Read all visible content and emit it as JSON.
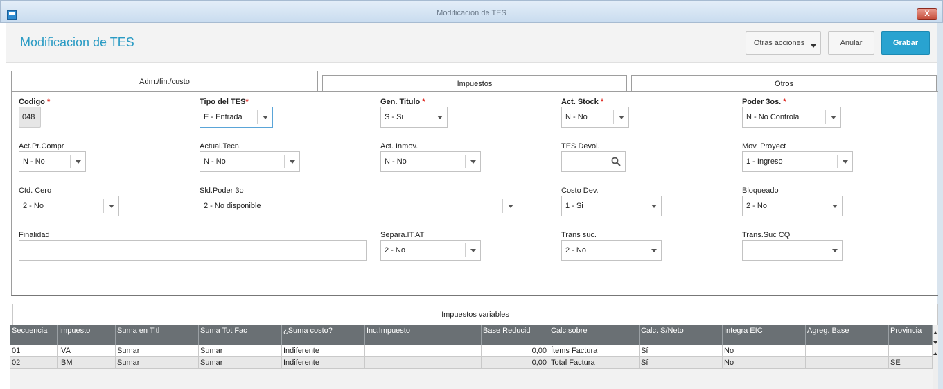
{
  "window": {
    "title": "Modificacion de TES",
    "close_label": "X"
  },
  "header": {
    "title": "Modificacion de TES",
    "other_actions": "Otras acciones",
    "cancel": "Anular",
    "save": "Grabar"
  },
  "tabs": [
    "Adm./fin./custo",
    "Impuestos",
    "Otros"
  ],
  "fields": {
    "codigo": {
      "label": "Codigo",
      "value": "048"
    },
    "tipo_tes": {
      "label": "Tipo del TES",
      "value": "E - Entrada"
    },
    "gen_titulo": {
      "label": "Gen. Titulo",
      "value": "S - Si"
    },
    "act_stock": {
      "label": "Act. Stock",
      "value": "N - No"
    },
    "poder_3os": {
      "label": "Poder 3os.",
      "value": "N - No Controla"
    },
    "act_pr_compr": {
      "label": "Act.Pr.Compr",
      "value": "N - No"
    },
    "actual_tecn": {
      "label": "Actual.Tecn.",
      "value": "N - No"
    },
    "act_inmov": {
      "label": "Act. Inmov.",
      "value": "N - No"
    },
    "tes_devol": {
      "label": "TES Devol.",
      "value": ""
    },
    "mov_proyect": {
      "label": "Mov. Proyect",
      "value": "1 - Ingreso"
    },
    "ctd_cero": {
      "label": "Ctd. Cero",
      "value": "2 - No"
    },
    "sld_poder_3o": {
      "label": "Sld.Poder 3o",
      "value": "2 - No disponible"
    },
    "costo_dev": {
      "label": "Costo Dev.",
      "value": "1 - Si"
    },
    "bloqueado": {
      "label": "Bloqueado",
      "value": "2 - No"
    },
    "finalidad": {
      "label": "Finalidad",
      "value": ""
    },
    "separa_it_at": {
      "label": "Separa.IT.AT",
      "value": "2 - No"
    },
    "trans_suc": {
      "label": "Trans suc.",
      "value": "2 - No"
    },
    "trans_suc_cq": {
      "label": "Trans.Suc CQ",
      "value": ""
    }
  },
  "grid": {
    "title": "Impuestos variables",
    "columns": [
      "Secuencia",
      "Impuesto",
      "Suma en Titl",
      "Suma Tot Fac",
      "¿Suma costo?",
      "Inc.Impuesto",
      "Base Reducid",
      "Calc.sobre",
      "Calc. S/Neto",
      "Integra EIC",
      "Agreg. Base",
      "Provincia"
    ],
    "rows": [
      [
        "01",
        "IVA",
        "Sumar",
        "Sumar",
        "Indiferente",
        "",
        "0,00",
        "Ítems Factura",
        "Sí",
        "No",
        "",
        ""
      ],
      [
        "02",
        "IBM",
        "Sumar",
        "Sumar",
        "Indiferente",
        "",
        "0,00",
        "Total Factura",
        "Sí",
        "No",
        "",
        "SE"
      ]
    ]
  },
  "icons": {
    "search": "search-icon",
    "dropdown": "chevron-down-icon",
    "close": "close-icon"
  }
}
